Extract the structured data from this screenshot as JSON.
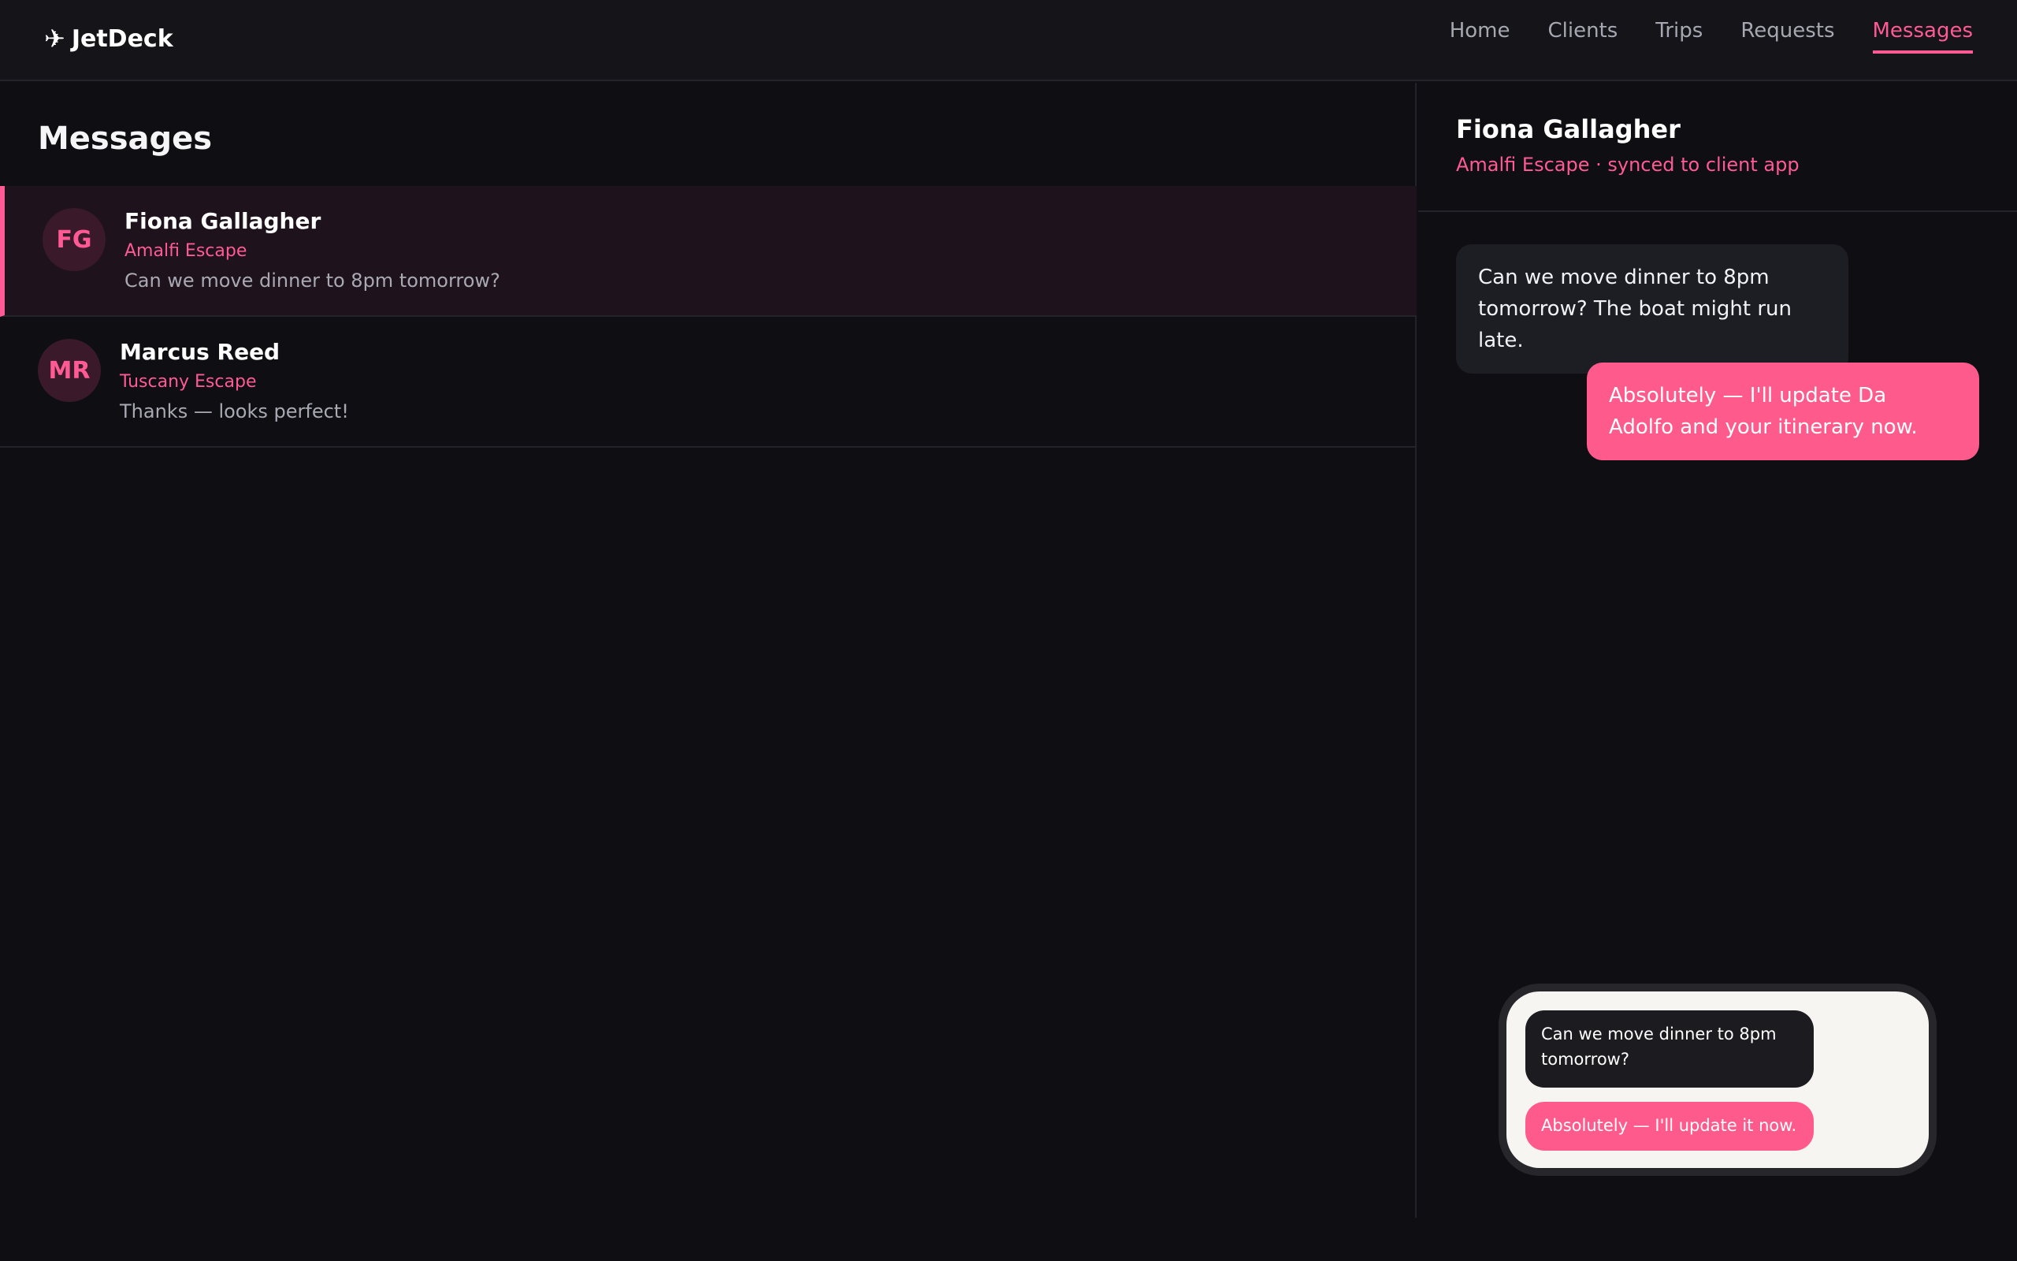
{
  "app": {
    "brand_icon": "✈",
    "brand_name": "JetDeck"
  },
  "nav": [
    {
      "label": "Home",
      "active": false
    },
    {
      "label": "Clients",
      "active": false
    },
    {
      "label": "Trips",
      "active": false
    },
    {
      "label": "Requests",
      "active": false
    },
    {
      "label": "Messages",
      "active": true
    }
  ],
  "messages_page": {
    "title": "Messages",
    "conversations": [
      {
        "initials": "FG",
        "name": "Fiona Gallagher",
        "trip": "Amalfi Escape",
        "preview": "Can we move dinner to 8pm tomorrow?",
        "active": true
      },
      {
        "initials": "MR",
        "name": "Marcus Reed",
        "trip": "Tuscany Escape",
        "preview": "Thanks — looks perfect!",
        "active": false
      }
    ]
  },
  "chat": {
    "name": "Fiona Gallagher",
    "subtitle": "Amalfi Escape · synced to client app",
    "messages": [
      {
        "direction": "in",
        "text": "Can we move dinner to 8pm tomorrow? The boat might run late."
      },
      {
        "direction": "out",
        "text": "Absolutely — I'll update Da Adolfo and your itinerary now."
      }
    ]
  },
  "phone_preview": {
    "messages": [
      {
        "direction": "in",
        "text": "Can we move dinner to 8pm tomorrow?"
      },
      {
        "direction": "out",
        "text": "Absolutely — I'll update it now."
      }
    ]
  },
  "colors": {
    "accent": "#ff5a93",
    "background": "#0f0f13",
    "topbar": "#141419",
    "incoming_bubble": "#1d1d24",
    "outgoing_bubble": "#ff5a8c"
  }
}
